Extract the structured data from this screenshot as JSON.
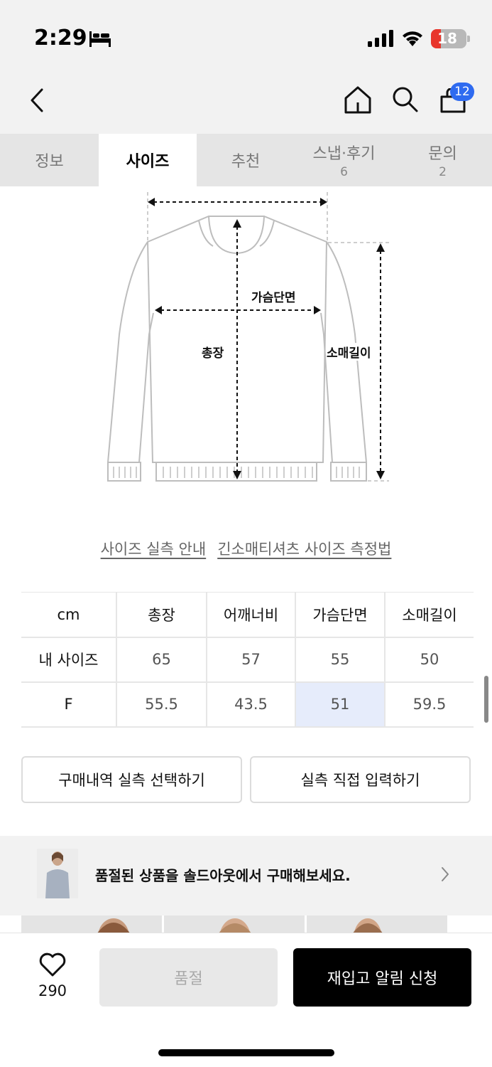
{
  "status_bar": {
    "time": "2:29",
    "battery": "18"
  },
  "nav": {
    "cart_count": "12"
  },
  "tabs": [
    {
      "label": "정보",
      "count": ""
    },
    {
      "label": "사이즈",
      "count": ""
    },
    {
      "label": "추천",
      "count": ""
    },
    {
      "label": "스냅·후기",
      "count": "6"
    },
    {
      "label": "문의",
      "count": "2"
    }
  ],
  "diagram": {
    "chest_label": "가슴단면",
    "length_label": "총장",
    "sleeve_label": "소매길이"
  },
  "guide_links": {
    "size_guide": "사이즈 실측 안내",
    "measure_method": "긴소매티셔츠 사이즈 측정법"
  },
  "size_table": {
    "headers": [
      "cm",
      "총장",
      "어깨너비",
      "가슴단면",
      "소매길이"
    ],
    "rows": [
      {
        "label": "내 사이즈",
        "values": [
          "65",
          "57",
          "55",
          "50"
        ]
      },
      {
        "label": "F",
        "values": [
          "55.5",
          "43.5",
          "51",
          "59.5"
        ]
      }
    ]
  },
  "buttons": {
    "select_history": "구매내역 실측 선택하기",
    "direct_input": "실측 직접 입력하기"
  },
  "soldout_banner": {
    "text": "품절된 상품을 솔드아웃에서 구매해보세요."
  },
  "bottom_bar": {
    "like_count": "290",
    "soldout_label": "품절",
    "restock_label": "재입고 알림 신청"
  },
  "colors": {
    "accent_blue": "#2f6bf0",
    "highlight_cell": "#e6ecfb",
    "battery_red": "#e8362c"
  }
}
